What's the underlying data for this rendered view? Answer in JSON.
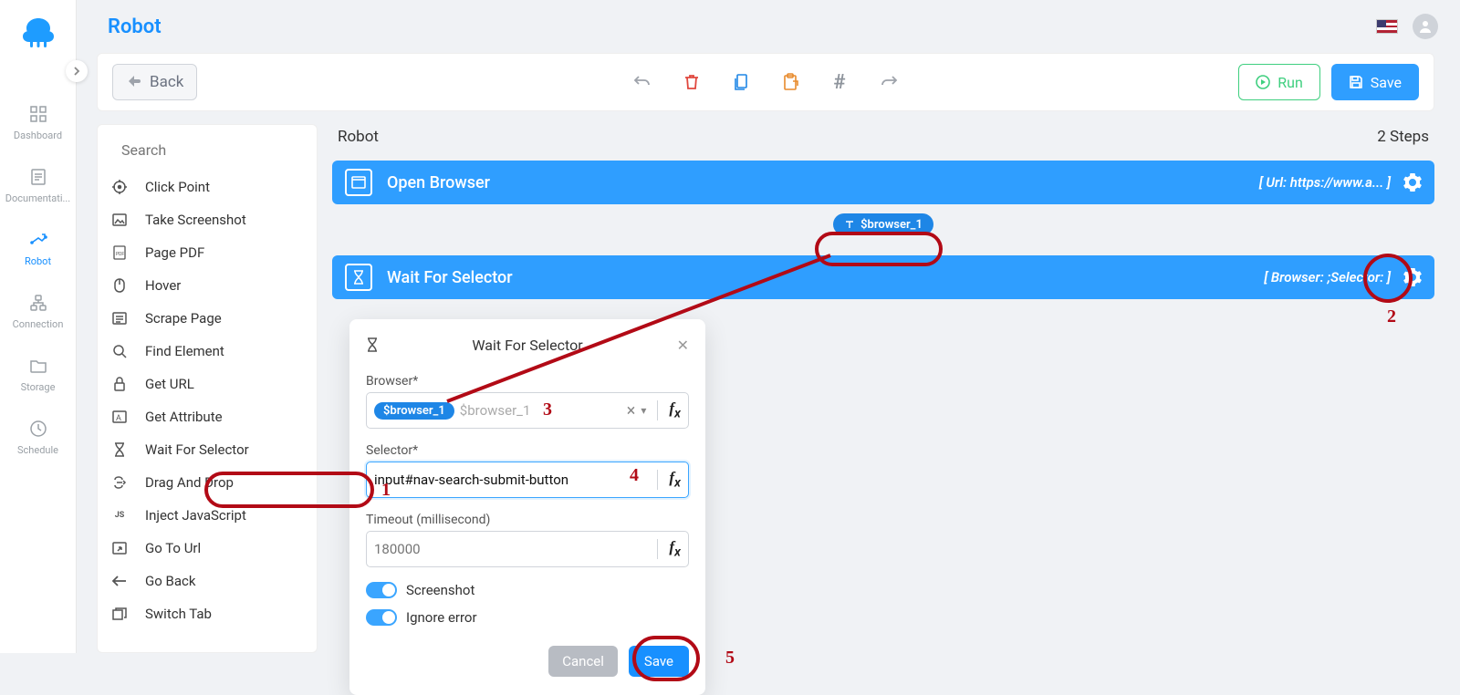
{
  "header": {
    "title": "Robot"
  },
  "nav": {
    "items": [
      {
        "label": "Dashboard"
      },
      {
        "label": "Documentati..."
      },
      {
        "label": "Robot"
      },
      {
        "label": "Connection"
      },
      {
        "label": "Storage"
      },
      {
        "label": "Schedule"
      }
    ]
  },
  "actionbar": {
    "back": "Back",
    "run": "Run",
    "save": "Save"
  },
  "search": {
    "placeholder": "Search"
  },
  "palette": [
    {
      "label": "Click Point"
    },
    {
      "label": "Take Screenshot"
    },
    {
      "label": "Page PDF"
    },
    {
      "label": "Hover"
    },
    {
      "label": "Scrape Page"
    },
    {
      "label": "Find Element"
    },
    {
      "label": "Get URL"
    },
    {
      "label": "Get Attribute"
    },
    {
      "label": "Wait For Selector"
    },
    {
      "label": "Drag And Drop"
    },
    {
      "label": "Inject JavaScript"
    },
    {
      "label": "Go To Url"
    },
    {
      "label": "Go Back"
    },
    {
      "label": "Switch Tab"
    }
  ],
  "canvas": {
    "title": "Robot",
    "steps_label": "2 Steps",
    "step1": {
      "title": "Open Browser",
      "right": "[ Url: https://www.a...  ]"
    },
    "link_chip": "$browser_1",
    "step2": {
      "title": "Wait For Selector",
      "right": "[ Browser:  ;Selector:  ]"
    }
  },
  "dialog": {
    "title": "Wait For Selector",
    "browser_label": "Browser*",
    "browser_pill": "$browser_1",
    "browser_ghost": "$browser_1",
    "selector_label": "Selector*",
    "selector_value": "input#nav-search-submit-button",
    "timeout_label": "Timeout (millisecond)",
    "timeout_placeholder": "180000",
    "screenshot_label": "Screenshot",
    "ignore_label": "Ignore error",
    "cancel": "Cancel",
    "save": "Save"
  },
  "annotations": {
    "1": "1",
    "2": "2",
    "3": "3",
    "4": "4",
    "5": "5"
  }
}
